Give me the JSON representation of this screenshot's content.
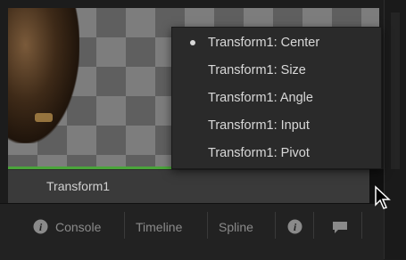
{
  "dropdown": {
    "items": [
      {
        "label": "Transform1: Center",
        "selected": true
      },
      {
        "label": "Transform1: Size",
        "selected": false
      },
      {
        "label": "Transform1: Angle",
        "selected": false
      },
      {
        "label": "Transform1: Input",
        "selected": false
      },
      {
        "label": "Transform1: Pivot",
        "selected": false
      }
    ]
  },
  "node_bar": {
    "label": "Transform1"
  },
  "toolbar": {
    "tabs": [
      "Console",
      "Timeline",
      "Spline"
    ],
    "icons": [
      "info-icon",
      "chat-icon"
    ]
  },
  "colors": {
    "viewer_dark": "#5f5f5f",
    "viewer_light": "#7d7d7d",
    "accent_green": "#4aa53a",
    "menu_bg": "#2a2a2a",
    "menu_text": "#d8d8d8",
    "tab_text": "#8a8a8a"
  }
}
